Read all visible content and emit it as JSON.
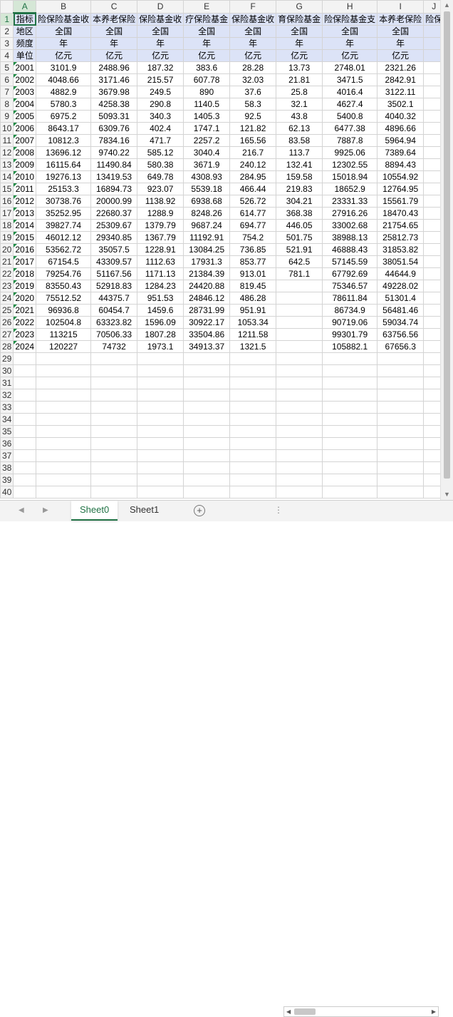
{
  "columns": [
    "A",
    "B",
    "C",
    "D",
    "E",
    "F",
    "G",
    "H",
    "I",
    "J"
  ],
  "row_numbers": [
    1,
    2,
    3,
    4,
    5,
    6,
    7,
    8,
    9,
    10,
    11,
    12,
    13,
    14,
    15,
    16,
    17,
    18,
    19,
    20,
    21,
    22,
    23,
    24,
    25,
    26,
    27,
    28,
    29,
    30,
    31,
    32,
    33,
    34,
    35,
    36,
    37,
    38,
    39,
    40
  ],
  "meta_rows": [
    {
      "label": "指标",
      "cells": [
        "险保险基金收",
        "本养老保险",
        "保险基金收",
        "疗保险基金",
        "保险基金收",
        "育保险基金",
        "险保险基金支",
        "本养老保险",
        "险保"
      ]
    },
    {
      "label": "地区",
      "cells": [
        "全国",
        "全国",
        "全国",
        "全国",
        "全国",
        "全国",
        "全国",
        "全国",
        ""
      ]
    },
    {
      "label": "频度",
      "cells": [
        "年",
        "年",
        "年",
        "年",
        "年",
        "年",
        "年",
        "年",
        ""
      ]
    },
    {
      "label": "单位",
      "cells": [
        "亿元",
        "亿元",
        "亿元",
        "亿元",
        "亿元",
        "亿元",
        "亿元",
        "亿元",
        ""
      ]
    }
  ],
  "data_rows": [
    {
      "year": "2001",
      "values": [
        "3101.9",
        "2488.96",
        "187.32",
        "383.6",
        "28.28",
        "13.73",
        "2748.01",
        "2321.26",
        ""
      ]
    },
    {
      "year": "2002",
      "values": [
        "4048.66",
        "3171.46",
        "215.57",
        "607.78",
        "32.03",
        "21.81",
        "3471.5",
        "2842.91",
        ""
      ]
    },
    {
      "year": "2003",
      "values": [
        "4882.9",
        "3679.98",
        "249.5",
        "890",
        "37.6",
        "25.8",
        "4016.4",
        "3122.11",
        ""
      ]
    },
    {
      "year": "2004",
      "values": [
        "5780.3",
        "4258.38",
        "290.8",
        "1140.5",
        "58.3",
        "32.1",
        "4627.4",
        "3502.1",
        ""
      ]
    },
    {
      "year": "2005",
      "values": [
        "6975.2",
        "5093.31",
        "340.3",
        "1405.3",
        "92.5",
        "43.8",
        "5400.8",
        "4040.32",
        ""
      ]
    },
    {
      "year": "2006",
      "values": [
        "8643.17",
        "6309.76",
        "402.4",
        "1747.1",
        "121.82",
        "62.13",
        "6477.38",
        "4896.66",
        ""
      ]
    },
    {
      "year": "2007",
      "values": [
        "10812.3",
        "7834.16",
        "471.7",
        "2257.2",
        "165.56",
        "83.58",
        "7887.8",
        "5964.94",
        ""
      ]
    },
    {
      "year": "2008",
      "values": [
        "13696.12",
        "9740.22",
        "585.12",
        "3040.4",
        "216.7",
        "113.7",
        "9925.06",
        "7389.64",
        ""
      ]
    },
    {
      "year": "2009",
      "values": [
        "16115.64",
        "11490.84",
        "580.38",
        "3671.9",
        "240.12",
        "132.41",
        "12302.55",
        "8894.43",
        ""
      ]
    },
    {
      "year": "2010",
      "values": [
        "19276.13",
        "13419.53",
        "649.78",
        "4308.93",
        "284.95",
        "159.58",
        "15018.94",
        "10554.92",
        ""
      ]
    },
    {
      "year": "2011",
      "values": [
        "25153.3",
        "16894.73",
        "923.07",
        "5539.18",
        "466.44",
        "219.83",
        "18652.9",
        "12764.95",
        ""
      ]
    },
    {
      "year": "2012",
      "values": [
        "30738.76",
        "20000.99",
        "1138.92",
        "6938.68",
        "526.72",
        "304.21",
        "23331.33",
        "15561.79",
        ""
      ]
    },
    {
      "year": "2013",
      "values": [
        "35252.95",
        "22680.37",
        "1288.9",
        "8248.26",
        "614.77",
        "368.38",
        "27916.26",
        "18470.43",
        ""
      ]
    },
    {
      "year": "2014",
      "values": [
        "39827.74",
        "25309.67",
        "1379.79",
        "9687.24",
        "694.77",
        "446.05",
        "33002.68",
        "21754.65",
        ""
      ]
    },
    {
      "year": "2015",
      "values": [
        "46012.12",
        "29340.85",
        "1367.79",
        "11192.91",
        "754.2",
        "501.75",
        "38988.13",
        "25812.73",
        ""
      ]
    },
    {
      "year": "2016",
      "values": [
        "53562.72",
        "35057.5",
        "1228.91",
        "13084.25",
        "736.85",
        "521.91",
        "46888.43",
        "31853.82",
        ""
      ]
    },
    {
      "year": "2017",
      "values": [
        "67154.5",
        "43309.57",
        "1112.63",
        "17931.3",
        "853.77",
        "642.5",
        "57145.59",
        "38051.54",
        ""
      ]
    },
    {
      "year": "2018",
      "values": [
        "79254.76",
        "51167.56",
        "1171.13",
        "21384.39",
        "913.01",
        "781.1",
        "67792.69",
        "44644.9",
        ""
      ]
    },
    {
      "year": "2019",
      "values": [
        "83550.43",
        "52918.83",
        "1284.23",
        "24420.88",
        "819.45",
        "",
        "75346.57",
        "49228.02",
        ""
      ]
    },
    {
      "year": "2020",
      "values": [
        "75512.52",
        "44375.7",
        "951.53",
        "24846.12",
        "486.28",
        "",
        "78611.84",
        "51301.4",
        ""
      ]
    },
    {
      "year": "2021",
      "values": [
        "96936.8",
        "60454.7",
        "1459.6",
        "28731.99",
        "951.91",
        "",
        "86734.9",
        "56481.46",
        ""
      ]
    },
    {
      "year": "2022",
      "values": [
        "102504.8",
        "63323.82",
        "1596.09",
        "30922.17",
        "1053.34",
        "",
        "90719.06",
        "59034.74",
        ""
      ]
    },
    {
      "year": "2023",
      "values": [
        "113215",
        "70506.33",
        "1807.28",
        "33504.86",
        "1211.58",
        "",
        "99301.79",
        "63756.56",
        ""
      ]
    },
    {
      "year": "2024",
      "values": [
        "120227",
        "74732",
        "1973.1",
        "34913.37",
        "1321.5",
        "",
        "105882.1",
        "67656.3",
        ""
      ]
    }
  ],
  "sheet_tabs": [
    {
      "name": "Sheet0",
      "active": true
    },
    {
      "name": "Sheet1",
      "active": false
    }
  ],
  "add_sheet_label": "+",
  "more_label": "⋮",
  "colors": {
    "accent": "#217346",
    "header_fill": "#dce3f7",
    "corner_tick": "#1e8c45"
  }
}
